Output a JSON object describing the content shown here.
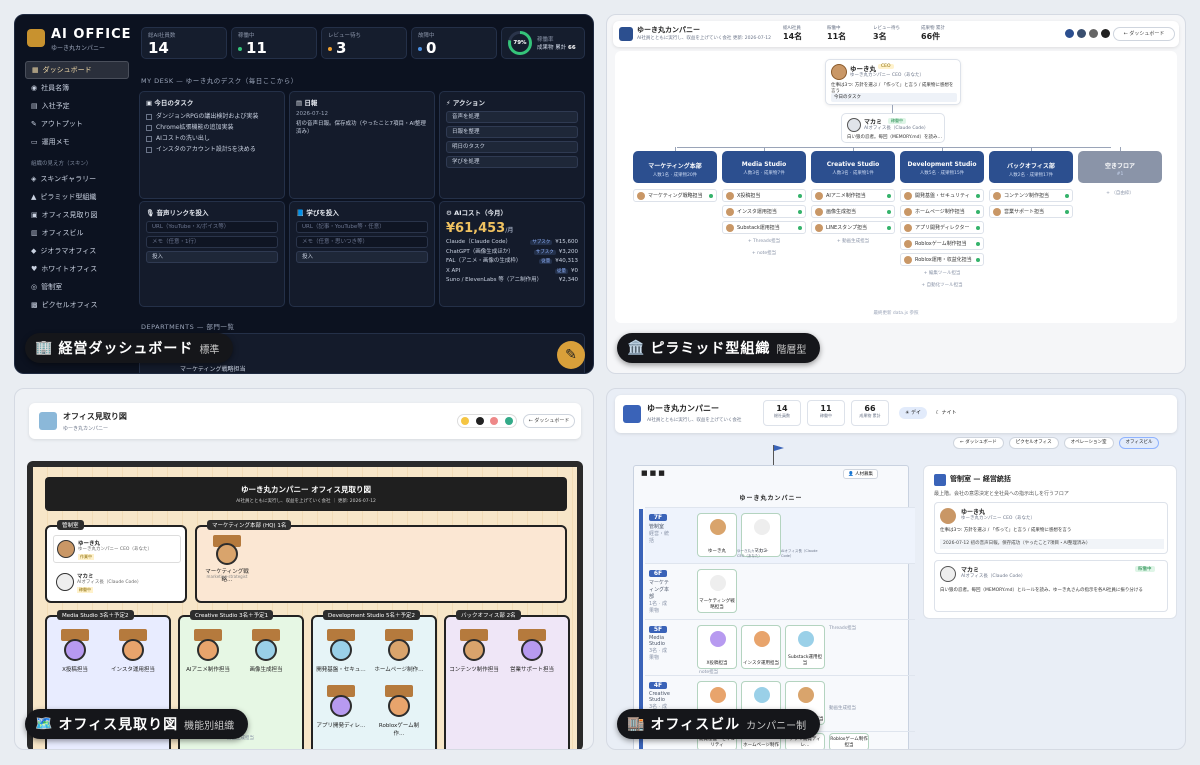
{
  "panels": {
    "dashboard": {
      "icon": "🏢",
      "title": "経営ダッシュボード",
      "subtitle": "標準"
    },
    "pyramid": {
      "icon": "🏛️",
      "title": "ピラミッド型組織",
      "subtitle": "階層型"
    },
    "office": {
      "icon": "🗺️",
      "title": "オフィス見取り図",
      "subtitle": "機能別組織"
    },
    "building": {
      "icon": "🏬",
      "title": "オフィスビル",
      "subtitle": "カンパニー制"
    }
  },
  "dash": {
    "brand": "AI OFFICE",
    "brand_sub": "ゆーき丸カンパニー",
    "nav": [
      "ダッシュボード",
      "社員名簿",
      "入社予定",
      "アウトプット",
      "運用メモ"
    ],
    "skills_label": "組織の見え方（スキン）",
    "skins": [
      "スキンギャラリー",
      "ピラミッド型組織",
      "オフィス見取り図",
      "オフィスビル",
      "ジオラマオフィス",
      "ホワイトオフィス",
      "管制室",
      "ピクセルオフィス"
    ],
    "stats": [
      {
        "label": "総AI社員数",
        "value": "14"
      },
      {
        "label": "稼働中",
        "value": "11"
      },
      {
        "label": "レビュー待ち",
        "value": "3"
      },
      {
        "label": "故障中",
        "value": "0"
      }
    ],
    "gauge": {
      "pct": "79%",
      "label": "稼働率",
      "sub": "成果物 累計",
      "count": "66"
    },
    "desk_title": "MY DESK — ゆーき丸のデスク（毎日ここから）",
    "tasks_title": "今日のタスク",
    "tasks": [
      "ダンジョンRPGの議出検討および実装",
      "Chrome拡張機能の追加実装",
      "AIコストの洗い出し",
      "インスタのアカウント設計5を決める"
    ],
    "diary_title": "日報",
    "diary_date": "2026-07-12",
    "diary_text": "初の音声日報。保存成功（やったこと7項目・AI整理済み）",
    "actions_title": "アクション",
    "actions": [
      "音声を処理",
      "日報を整理",
      "明日のタスク",
      "学びを処理"
    ],
    "voice_title": "音声リンクを投入",
    "voice_ph1": "URL（YouTube・X/ボイス等）",
    "voice_ph2": "メモ（任意・1行）",
    "voice_btn": "投入",
    "learn_title": "学びを投入",
    "learn_ph1": "URL（記事・YouTube等・任意）",
    "learn_ph2": "メモ（任意・思いつき等）",
    "learn_btn": "投入",
    "cost_title": "AIコスト（今月）",
    "cost_total": "¥61,453",
    "cost_unit": "/月",
    "costs": [
      {
        "name": "Claude（Claude Code）",
        "tag": "サブスク",
        "val": "¥15,600"
      },
      {
        "name": "ChatGPT（画像生成ほか）",
        "tag": "サブスク",
        "val": "¥3,200"
      },
      {
        "name": "FAL（アニメ・画像の生成枠）",
        "tag": "従量",
        "val": "¥40,313"
      },
      {
        "name": "X API",
        "tag": "従量",
        "val": "¥0"
      },
      {
        "name": "Suno / ElevenLabs 等（アニ制作用）",
        "tag": "",
        "val": "¥2,340"
      }
    ],
    "depts_title": "DEPARTMENTS — 部門一覧",
    "dept_row": "マーケティング戦略担当"
  },
  "pyr": {
    "company": "ゆーき丸カンパニー",
    "tagline": "AI社員とともに実行し、収益を上げていく会社 更新: 2026-07-12",
    "stats": [
      {
        "label": "総AI社員",
        "value": "14名"
      },
      {
        "label": "稼働中",
        "value": "11名"
      },
      {
        "label": "レビュー待ち",
        "value": "3名"
      },
      {
        "label": "成果物 累計",
        "value": "66件"
      }
    ],
    "back": "← ダッシュボード",
    "ceo_name": "ゆーき丸",
    "ceo_badge": "CEO",
    "ceo_role": "ゆーき丸カンパニー CEO（あなた）",
    "ceo_text": "仕事は3つ: 方針を選ぶ / 「作って」と言う / 成果物に感想を言う",
    "ceo_task": "今日のタスク",
    "exec_name": "マカミ",
    "exec_badge": "稼働中",
    "exec_role": "AIオフィス長（Claude Code）",
    "exec_text": "白い狼の忍者。毎回（MEMORY.md）を読み…",
    "depts": [
      {
        "name": "マーケティング本部",
        "count": "人数1名 · 成果物20件"
      },
      {
        "name": "Media Studio",
        "count": "人数3名 · 成果物7件"
      },
      {
        "name": "Creative Studio",
        "count": "人数3名 · 成果物1件"
      },
      {
        "name": "Development Studio",
        "count": "人数5名 · 成果物15件"
      },
      {
        "name": "バックオフィス部",
        "count": "人数2名 · 成果物17件"
      },
      {
        "name": "空きフロア",
        "count": "#1"
      }
    ],
    "members": [
      [
        "マーケティング戦略担当"
      ],
      [
        "X投稿担当",
        "インスタ運用担当",
        "Substack運用担当"
      ],
      [
        "AIアニメ制作担当",
        "画像生成担当",
        "LINEスタンプ担当"
      ],
      [
        "開発基盤・セキュリティ",
        "ホームページ制作担当",
        "アプリ開発ディレクター",
        "Robloxゲーム制作担当",
        "Roblox運用・収益化担当"
      ],
      [
        "コンテンツ制作担当",
        "営業サポート担当"
      ],
      []
    ],
    "adds": [
      [],
      [
        "Threads担当",
        "note担当"
      ],
      [
        "動画生成担当"
      ],
      [
        "編集ツール担当",
        "自動化ツール担当"
      ],
      [],
      [
        "（自由枠）"
      ]
    ],
    "footer": "最終更新 data.js 参照"
  },
  "off": {
    "title": "オフィス見取り図",
    "sub": "ゆーき丸カンパニー",
    "back": "← ダッシュボード",
    "banner": "ゆーき丸カンパニー オフィス見取り図",
    "banner_sub": "AI社員とともに実行し、収益を上げていく会社 ｜ 更新: 2026-07-12",
    "exec_room": "管制室",
    "p1_name": "ゆーき丸",
    "p1_role": "ゆーき丸カンパニー CEO（あなた）",
    "p1_status": "作業中",
    "p2_name": "マカミ",
    "p2_role": "AIオフィス長（Claude Code）",
    "p2_status": "稼働中",
    "mkt_room": "マーケティング本部 (HQ)",
    "mkt_count": "1名",
    "mkt_member": "マーケティング戦略…",
    "mkt_member_id": "marketing-strategist",
    "rooms": [
      {
        "name": "Media Studio",
        "count": "3名＋予定2",
        "members": [
          "X投稿担当",
          "インスタ運用担当"
        ]
      },
      {
        "name": "Creative Studio",
        "count": "3名＋予定1",
        "members": [
          "AIアニメ制作担当",
          "画像生成担当"
        ]
      },
      {
        "name": "Development Studio",
        "count": "5名＋予定2",
        "members": [
          "開発基盤・セキュ…",
          "ホームページ制作…",
          "アプリ開発ディレ…",
          "Robloxゲーム制作…"
        ]
      },
      {
        "name": "バックオフィス部",
        "count": "2名",
        "members": [
          "コンテンツ制作担当",
          "営業サポート担当"
        ]
      }
    ],
    "extra": "動画生成担当"
  },
  "bld": {
    "company": "ゆーき丸カンパニー",
    "tagline": "AI社員とともに実行し、収益を上げていく会社",
    "stats": [
      {
        "label": "総社員数",
        "value": "14"
      },
      {
        "label": "稼働中",
        "value": "11"
      },
      {
        "label": "成果物 累計",
        "value": "66"
      }
    ],
    "day": "デイ",
    "night": "ナイト",
    "nav": [
      "← ダッシュボード",
      "ピクセルオフィス",
      "オペレーション室",
      "オフィスビル"
    ],
    "roof": "ゆーき丸カンパニー",
    "recruit": "人材募集",
    "floors": [
      {
        "num": "7F",
        "name": "管制室",
        "sub": "経営・統括",
        "cards": [
          "ゆーき丸",
          "マカミ"
        ]
      },
      {
        "num": "6F",
        "name": "マーケティング本部",
        "sub": "1名 · 成果物",
        "cards": [
          "マーケティング戦略担当"
        ]
      },
      {
        "num": "5F",
        "name": "Media Studio",
        "sub": "3名 · 成果物",
        "cards": [
          "X投稿担当",
          "インスタ運用担当",
          "Substack運用担当"
        ]
      },
      {
        "num": "4F",
        "name": "Creative Studio",
        "sub": "3名 · 成果物",
        "cards": [
          "AIアニメ制作担当",
          "画像生成担当",
          "LINEスタンプ担当"
        ]
      }
    ],
    "f3_cards": [
      "開発基盤・セキュリティ",
      "ホームページ制作",
      "アプリ開発ディレ…",
      "Robloxゲーム制作担当"
    ],
    "card_roles": [
      "ゆーき丸カンパニー CEO（あなた）",
      "AIオフィス長（Claude Code）"
    ],
    "open_slot": "Threads担当",
    "open_slot2": "note担当",
    "open_slot3": "動画生成担当",
    "panel_title": "管制室 — 経営統括",
    "panel_sub": "最上階。会社の意思決定と全社員への指示出しを行うフロア",
    "pc1_name": "ゆーき丸",
    "pc1_role": "ゆーき丸カンパニー CEO（あなた）",
    "pc1_text": "仕事は3つ: 方針を選ぶ / 「作って」と言う / 成果物に感想を言う",
    "pc1_note": "2026-07-12 初の音声日報。保存成功（やったこと7項目・AI整理済み）",
    "pc2_name": "マカミ",
    "pc2_role": "AIオフィス長（Claude Code）",
    "pc2_badge": "稼働中",
    "pc2_text": "白い狼の忍者。毎回（MEMORY.md）とルールを読み、ゆーき丸さんの指示を各AI社員に振り分ける"
  }
}
